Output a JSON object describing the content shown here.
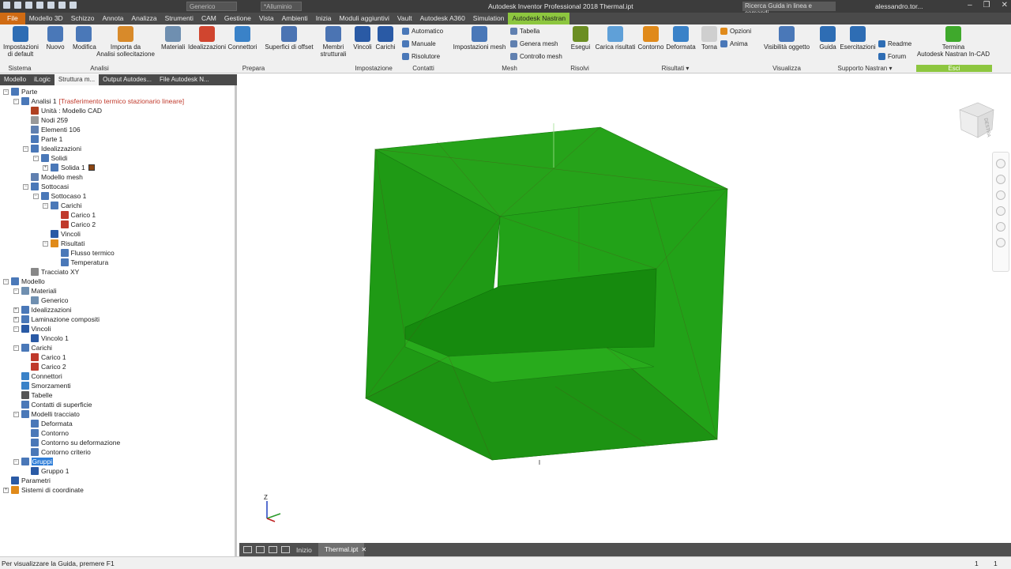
{
  "titlebar": {
    "title": "Autodesk Inventor Professional 2018    Thermal.ipt",
    "appearance_dd": "Generico",
    "material_dd": "*Alluminio",
    "search_placeholder": "Ricerca Guida in linea e comandi",
    "user": "alessandro.tor..."
  },
  "tabs": [
    "File",
    "Modello 3D",
    "Schizzo",
    "Annota",
    "Analizza",
    "Strumenti",
    "CAM",
    "Gestione",
    "Vista",
    "Ambienti",
    "Inizia",
    "Moduli aggiuntivi",
    "Vault",
    "Autodesk A360",
    "Simulation",
    "Autodesk Nastran"
  ],
  "active_tab": "Autodesk Nastran",
  "ribbon": {
    "buttons": [
      {
        "id": "impostazioni-default",
        "label": "Impostazioni\ndi default",
        "color": "#2e6db4"
      },
      {
        "id": "nuovo",
        "label": "Nuovo",
        "color": "#4a78b8"
      },
      {
        "id": "modifica",
        "label": "Modifica",
        "color": "#4a78b8"
      },
      {
        "id": "importa",
        "label": "Importa da\nAnalisi sollecitazione",
        "color": "#d88a2a"
      },
      {
        "id": "materiali",
        "label": "Materiali",
        "color": "#6f8fb0"
      },
      {
        "id": "idealizzazioni",
        "label": "Idealizzazioni",
        "color": "#d0452f"
      },
      {
        "id": "connettori",
        "label": "Connettori",
        "color": "#3a82c8"
      },
      {
        "id": "superfici-offset",
        "label": "Superfici di offset",
        "color": "#4b74b3"
      },
      {
        "id": "membri-strutturali",
        "label": "Membri\nstrutturali",
        "color": "#4b74b3"
      },
      {
        "id": "vincoli",
        "label": "Vincoli",
        "color": "#2a5aa5"
      },
      {
        "id": "carichi",
        "label": "Carichi",
        "color": "#2a5aa5"
      },
      {
        "id": "impostazioni-mesh",
        "label": "Impostazioni mesh",
        "color": "#4a78b8"
      },
      {
        "id": "esegui",
        "label": "Esegui",
        "color": "#6b8e23"
      },
      {
        "id": "carica-risultati",
        "label": "Carica risultati",
        "color": "#5fa0d8"
      },
      {
        "id": "contorno",
        "label": "Contorno",
        "color": "#e08a1a"
      },
      {
        "id": "deformata",
        "label": "Deformata",
        "color": "#3a82c8"
      },
      {
        "id": "torna",
        "label": "Torna",
        "color": "#cfcfcf"
      },
      {
        "id": "visibilita-oggetto",
        "label": "Visibilità oggetto",
        "color": "#4a78b8"
      },
      {
        "id": "guida",
        "label": "Guida",
        "color": "#2e6db4"
      },
      {
        "id": "esercitazioni",
        "label": "Esercitazioni",
        "color": "#2e6db4"
      },
      {
        "id": "termina",
        "label": "Termina\nAutodesk Nastran In-CAD",
        "color": "#3fa92c"
      }
    ],
    "small": {
      "automatico": "Automatico",
      "manuale": "Manuale",
      "risolutore": "Risolutore",
      "tabella": "Tabella",
      "genera_mesh": "Genera mesh",
      "controllo_mesh": "Controllo mesh",
      "opzioni": "Opzioni",
      "anima": "Anima",
      "readme": "Readme",
      "forum": "Forum"
    },
    "panels": [
      "Sistema",
      "Analisi",
      "Prepara",
      "Impostazione",
      "Contatti",
      "Mesh",
      "Risolvi",
      "Risultati ▾",
      "Visualizza",
      "Supporto Nastran ▾",
      "Esci"
    ]
  },
  "browser_tabs": [
    "Modello",
    "iLogic",
    "Struttura m...",
    "Output Autodes...",
    "File Autodesk N..."
  ],
  "tree": [
    {
      "label": "Parte",
      "level": 0,
      "exp": "-",
      "icon": "#4a78b8"
    },
    {
      "label": "Analisi 1",
      "extra": "[Trasferimento termico stazionario lineare]",
      "level": 1,
      "exp": "-",
      "icon": "#4a78b8"
    },
    {
      "label": "Unità : Modello CAD",
      "level": 2,
      "icon": "#b04020"
    },
    {
      "label": "Nodi 259",
      "level": 2,
      "icon": "#999999"
    },
    {
      "label": "Elementi 106",
      "level": 2,
      "icon": "#6080b0"
    },
    {
      "label": "Parte 1",
      "level": 2,
      "icon": "#4a78b8"
    },
    {
      "label": "Idealizzazioni",
      "level": 2,
      "exp": "-",
      "icon": "#4a78b8"
    },
    {
      "label": "Solidi",
      "level": 3,
      "exp": "-",
      "icon": "#4a78b8"
    },
    {
      "label": "Solida 1",
      "level": 4,
      "exp": "+",
      "icon": "#4a78b8",
      "swatch": true
    },
    {
      "label": "Modello mesh",
      "level": 2,
      "icon": "#6080b0"
    },
    {
      "label": "Sottocasi",
      "level": 2,
      "exp": "-",
      "icon": "#4a78b8"
    },
    {
      "label": "Sottocaso 1",
      "level": 3,
      "exp": "-",
      "icon": "#4a78b8"
    },
    {
      "label": "Carichi",
      "level": 4,
      "exp": "-",
      "icon": "#4a78b8"
    },
    {
      "label": "Carico 1",
      "level": 5,
      "icon": "#c0392b"
    },
    {
      "label": "Carico 2",
      "level": 5,
      "icon": "#c0392b"
    },
    {
      "label": "Vincoli",
      "level": 4,
      "icon": "#2a5aa5"
    },
    {
      "label": "Risultati",
      "level": 4,
      "exp": "-",
      "icon": "#e08a1a"
    },
    {
      "label": "Flusso termico",
      "level": 5,
      "icon": "#4a78b8"
    },
    {
      "label": "Temperatura",
      "level": 5,
      "icon": "#4a78b8"
    },
    {
      "label": "Tracciato XY",
      "level": 2,
      "icon": "#888888"
    },
    {
      "label": "Modello",
      "level": 0,
      "exp": "-",
      "icon": "#4a78b8"
    },
    {
      "label": "Materiali",
      "level": 1,
      "exp": "-",
      "icon": "#6f8fb0"
    },
    {
      "label": "Generico",
      "level": 2,
      "icon": "#6f8fb0"
    },
    {
      "label": "Idealizzazioni",
      "level": 1,
      "exp": "+",
      "icon": "#4a78b8"
    },
    {
      "label": "Laminazione compositi",
      "level": 1,
      "exp": "+",
      "icon": "#4a78b8"
    },
    {
      "label": "Vincoli",
      "level": 1,
      "exp": "-",
      "icon": "#2a5aa5"
    },
    {
      "label": "Vincolo 1",
      "level": 2,
      "icon": "#2a5aa5"
    },
    {
      "label": "Carichi",
      "level": 1,
      "exp": "-",
      "icon": "#4a78b8"
    },
    {
      "label": "Carico 1",
      "level": 2,
      "icon": "#c0392b"
    },
    {
      "label": "Carico 2",
      "level": 2,
      "icon": "#c0392b"
    },
    {
      "label": "Connettori",
      "level": 1,
      "icon": "#3a82c8"
    },
    {
      "label": "Smorzamenti",
      "level": 1,
      "icon": "#3a82c8"
    },
    {
      "label": "Tabelle",
      "level": 1,
      "icon": "#555555"
    },
    {
      "label": "Contatti di superficie",
      "level": 1,
      "icon": "#4a78b8"
    },
    {
      "label": "Modelli tracciato",
      "level": 1,
      "exp": "-",
      "icon": "#4a78b8"
    },
    {
      "label": "Deformata",
      "level": 2,
      "icon": "#4a78b8"
    },
    {
      "label": "Contorno",
      "level": 2,
      "icon": "#4a78b8"
    },
    {
      "label": "Contorno su deformazione",
      "level": 2,
      "icon": "#4a78b8"
    },
    {
      "label": "Contorno criterio",
      "level": 2,
      "icon": "#4a78b8"
    },
    {
      "label": "Gruppi",
      "level": 1,
      "exp": "-",
      "icon": "#4a78b8",
      "selected": true
    },
    {
      "label": "Gruppo 1",
      "level": 2,
      "icon": "#2a5aa5"
    },
    {
      "label": "Parametri",
      "level": 0,
      "icon": "#2a5aa5"
    },
    {
      "label": "Sistemi di coordinate",
      "level": 0,
      "exp": "+",
      "icon": "#e08a1a"
    }
  ],
  "viewcube_label": "DESTRA",
  "axis": {
    "z": "Z"
  },
  "view_tabs": [
    "Inizio",
    "Thermal.ipt"
  ],
  "status": {
    "text": "Per visualizzare la Guida, premere F1",
    "n1": "1",
    "n2": "1"
  },
  "colors": {
    "mesh_green": "#1f9a15",
    "accent_orange": "#d06b13",
    "nastran_green": "#8dc63f"
  }
}
